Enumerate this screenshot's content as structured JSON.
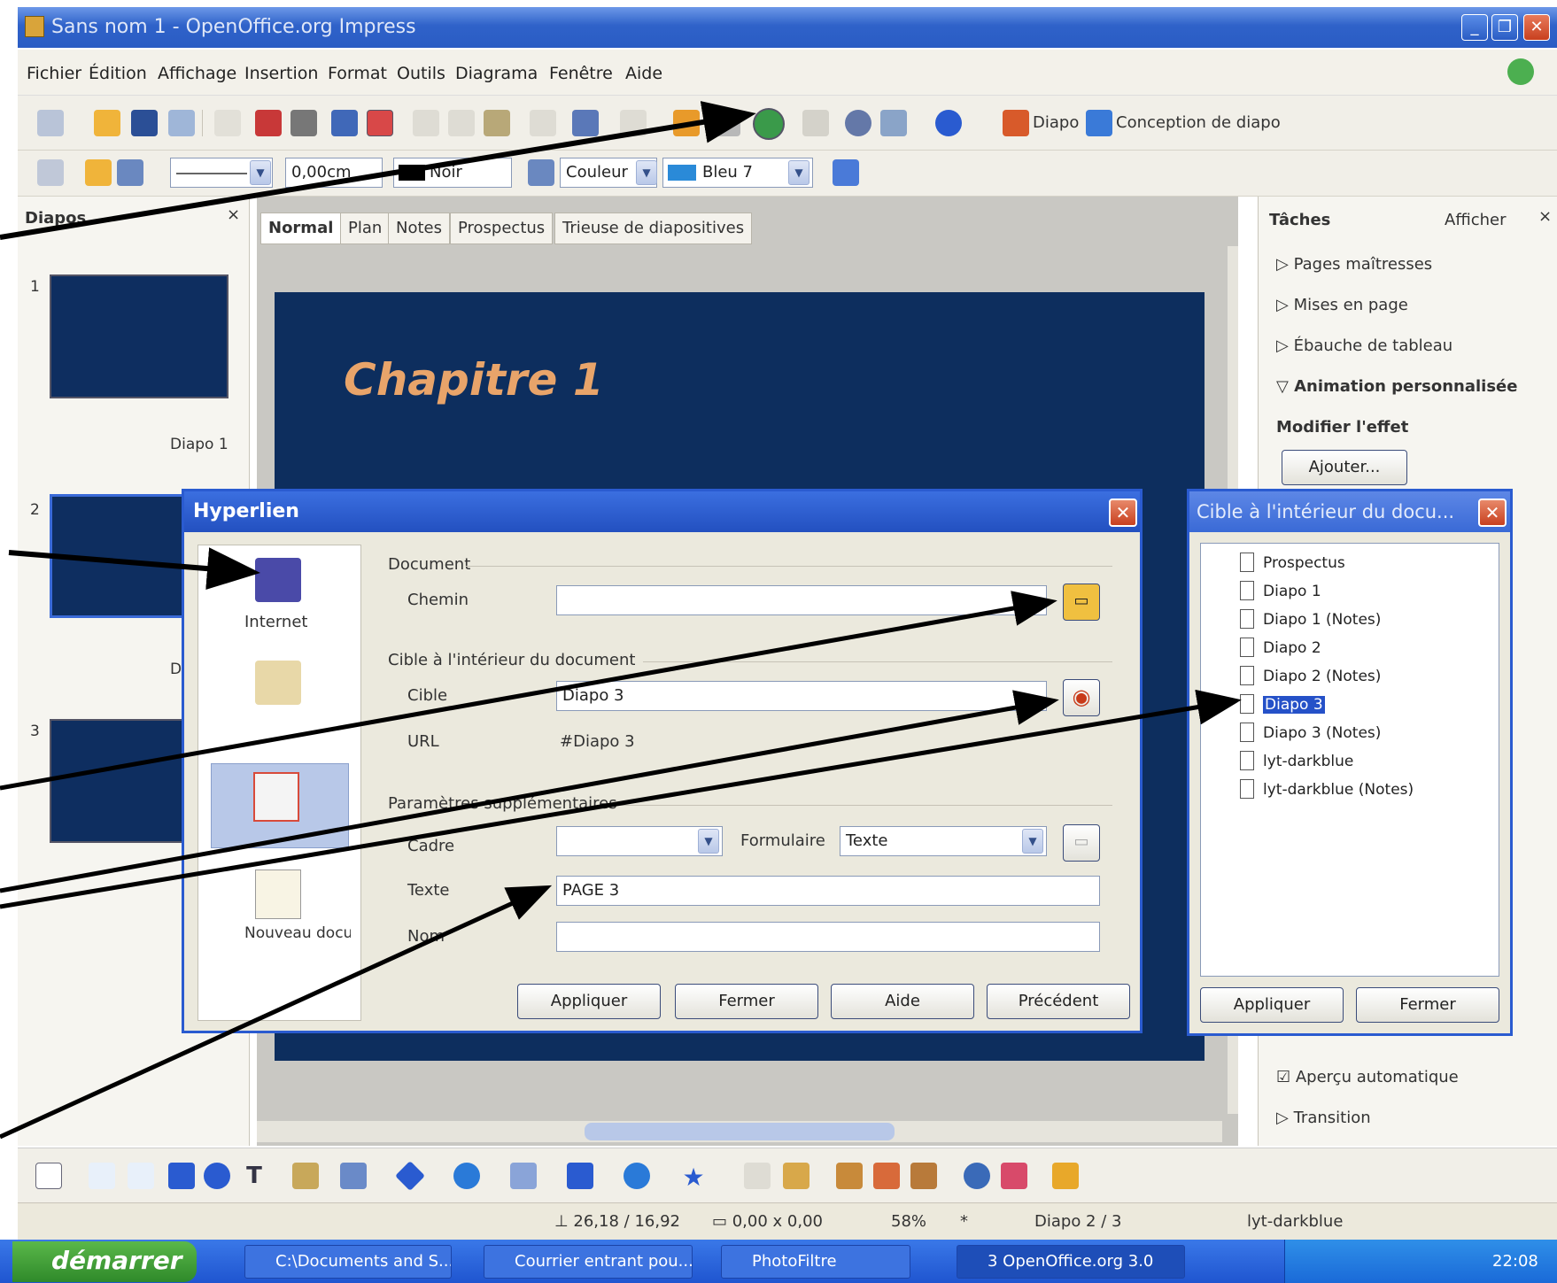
{
  "window": {
    "title": "Sans nom 1 - OpenOffice.org Impress"
  },
  "menu": [
    "Fichier",
    "Édition",
    "Affichage",
    "Insertion",
    "Format",
    "Outils",
    "Diagrama",
    "Fenêtre",
    "Aide"
  ],
  "toolbar1": {
    "diapo_label": "Diapo",
    "conception_label": "Conception de diapo"
  },
  "toolbar2": {
    "line_width": "0,00cm",
    "line_color": "Noir",
    "fill_type": "Couleur",
    "fill_color": "Bleu 7"
  },
  "slides_panel": {
    "title": "Diapos",
    "slides": [
      {
        "num": "1",
        "label": "Diapo 1"
      },
      {
        "num": "2",
        "label": "D"
      },
      {
        "num": "3",
        "label": ""
      }
    ]
  },
  "view_tabs": [
    "Normal",
    "Plan",
    "Notes",
    "Prospectus",
    "Trieuse de diapositives"
  ],
  "slide": {
    "title": "Chapitre 1"
  },
  "task_panel": {
    "title": "Tâches",
    "view_label": "Afficher",
    "sections": [
      "Pages maîtresses",
      "Mises en page",
      "Ébauche de tableau",
      "Animation personnalisée"
    ],
    "modify_label": "Modifier l'effet",
    "add_button": "Ajouter...",
    "auto_preview": "Aperçu automatique",
    "transition": "Transition"
  },
  "hyperlink_dialog": {
    "title": "Hyperlien",
    "categories": [
      "Internet",
      "Mail & news",
      "Document",
      "Nouveau document"
    ],
    "document_group": "Document",
    "path_label": "Chemin",
    "path_value": "",
    "target_group": "Cible à l'intérieur du document",
    "target_label": "Cible",
    "target_value": "Diapo 3",
    "url_label": "URL",
    "url_value": "#Diapo 3",
    "extra_group": "Paramètres supplémentaires",
    "frame_label": "Cadre",
    "form_label": "Formulaire",
    "form_value": "Texte",
    "text_label": "Texte",
    "text_value": "PAGE 3",
    "name_label": "Nom",
    "name_value": "",
    "buttons": [
      "Appliquer",
      "Fermer",
      "Aide",
      "Précédent"
    ]
  },
  "target_dialog": {
    "title": "Cible à l'intérieur du docu...",
    "items": [
      "Prospectus",
      "Diapo 1",
      "Diapo 1 (Notes)",
      "Diapo 2",
      "Diapo 2 (Notes)",
      "Diapo 3",
      "Diapo 3 (Notes)",
      "lyt-darkblue",
      "lyt-darkblue (Notes)"
    ],
    "selected_index": 5,
    "buttons": [
      "Appliquer",
      "Fermer"
    ]
  },
  "statusbar": {
    "position": "26,18 / 16,92",
    "size": "0,00 x 0,00",
    "zoom": "58%",
    "modified": "*",
    "page": "Diapo 2 / 3",
    "layout": "lyt-darkblue"
  },
  "taskbar": {
    "start": "démarrer",
    "tasks": [
      "C:\\Documents and S...",
      "Courrier entrant pou...",
      "PhotoFiltre",
      "3 OpenOffice.org 3.0"
    ],
    "clock": "22:08"
  },
  "colors": {
    "slide_bg": "#0d2e5e",
    "slide_title": "#e8a46a",
    "xp_blue": "#2a5bd0",
    "selection": "#2551c8"
  }
}
